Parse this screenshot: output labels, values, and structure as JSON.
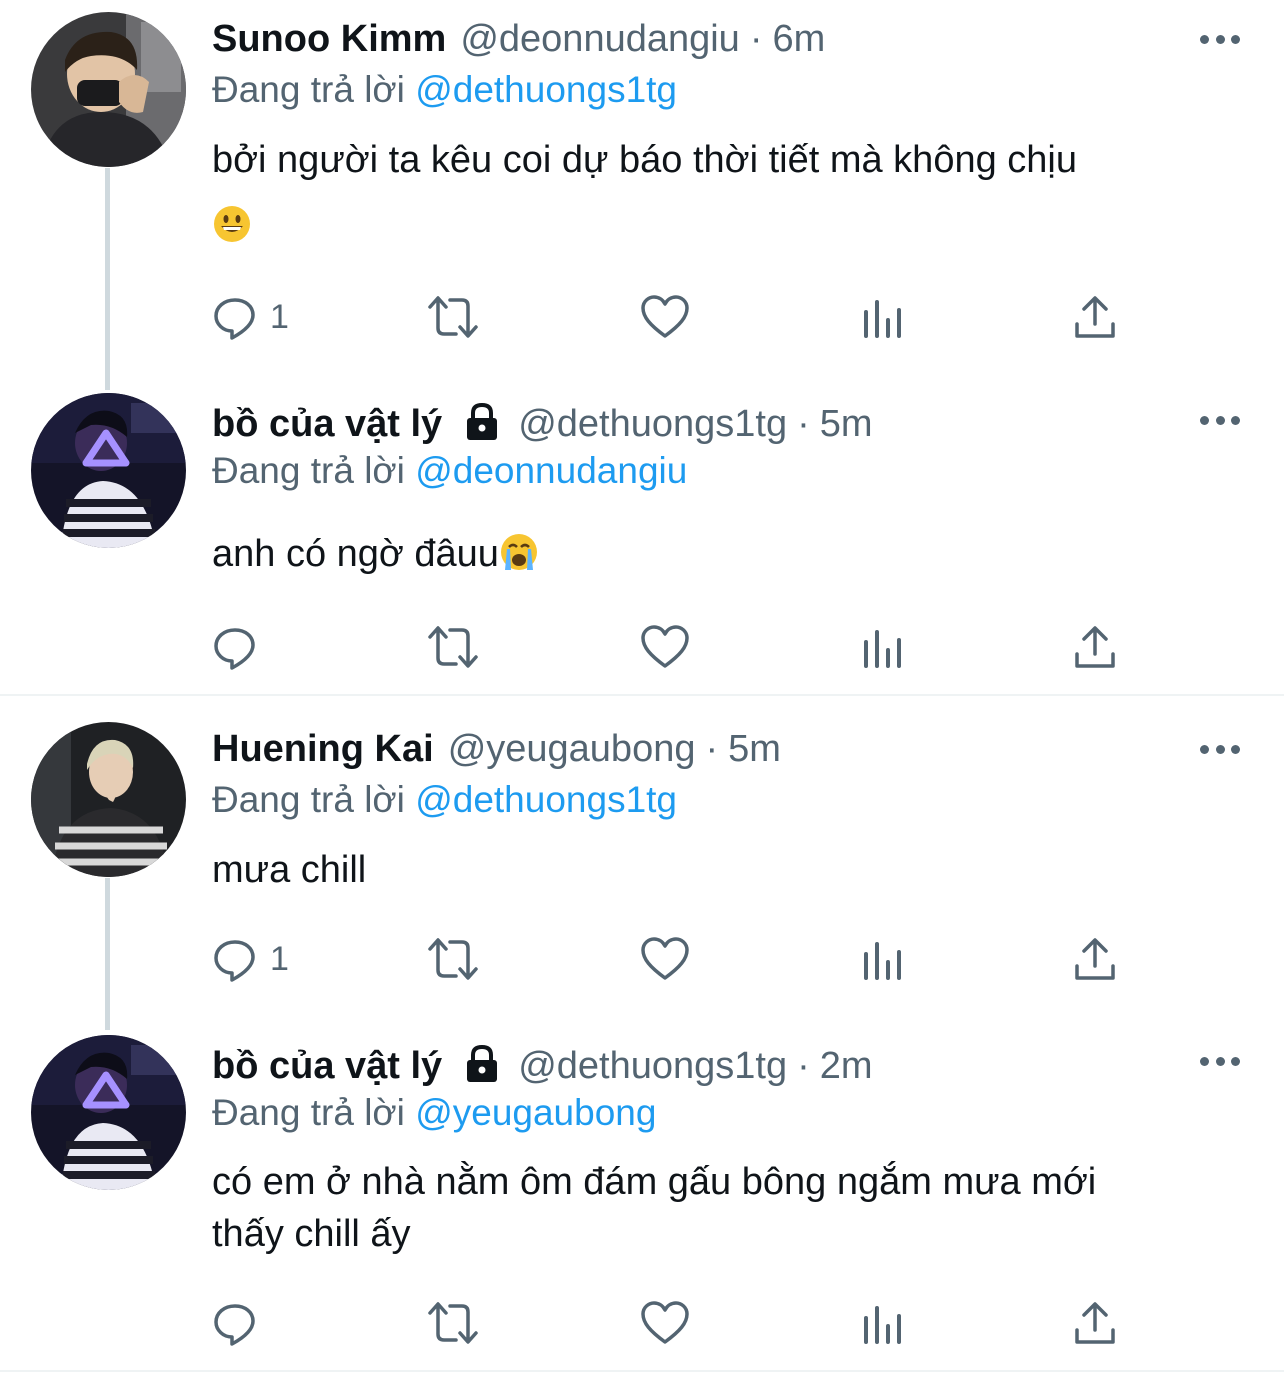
{
  "ui": {
    "reply_prefix": "Đang trả lời",
    "dot": "·"
  },
  "colors": {
    "accent": "#1d9bf0",
    "secondary": "#536471",
    "text": "#0f1419",
    "divider": "#eff3f4"
  },
  "tweets": [
    {
      "name": "Sunoo Kimm",
      "handle": "@deonnudangiu",
      "time": "6m",
      "locked": false,
      "reply_to": "@dethuongs1tg",
      "text": "bởi người ta kêu coi dự báo thời tiết mà không chịu",
      "emoji": "grinning-face",
      "reply_count": "1"
    },
    {
      "name": "bồ của vật lý",
      "handle": "@dethuongs1tg",
      "time": "5m",
      "locked": true,
      "reply_to": "@deonnudangiu",
      "text": "anh có ngờ đâuu",
      "emoji": "loudly-crying-face",
      "reply_count": ""
    },
    {
      "name": "Huening Kai",
      "handle": "@yeugaubong",
      "time": "5m",
      "locked": false,
      "reply_to": "@dethuongs1tg",
      "text": "mưa chill",
      "emoji": "",
      "reply_count": "1"
    },
    {
      "name": "bồ của vật lý",
      "handle": "@dethuongs1tg",
      "time": "2m",
      "locked": true,
      "reply_to": "@yeugaubong",
      "text_line1": "có em ở nhà nằm ôm đám gấu bông ngắm mưa mới",
      "text_line2": "thấy chill ấy",
      "emoji": "",
      "reply_count": ""
    }
  ]
}
